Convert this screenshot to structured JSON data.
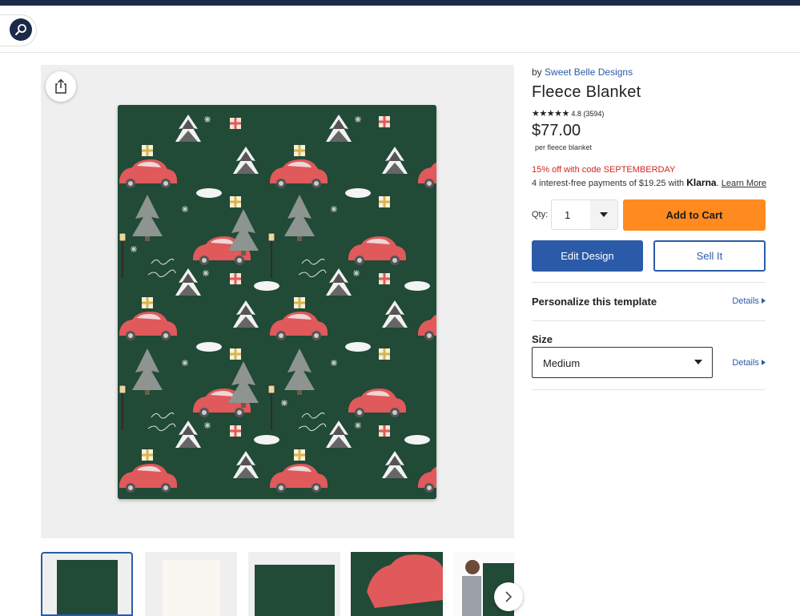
{
  "header": {
    "search_icon": "search-icon"
  },
  "product": {
    "byline_prefix": "by",
    "seller": "Sweet Belle Designs",
    "title": "Fleece Blanket",
    "stars": "★★★★★",
    "rating": "4.8",
    "review_count": "(3594)",
    "price": "$77.00",
    "per_unit": "per fleece blanket",
    "promo": "15% off with code SEPTEMBERDAY",
    "klarna_text": "4 interest-free payments of $19.25 with",
    "klarna_brand": "Klarna",
    "klarna_period": ".",
    "learn_more": "Learn More"
  },
  "purchase": {
    "qty_label": "Qty:",
    "qty_value": "1",
    "add_to_cart": "Add to Cart",
    "edit_design": "Edit Design",
    "sell_it": "Sell It"
  },
  "personalize": {
    "title": "Personalize this template",
    "details": "Details"
  },
  "size": {
    "label": "Size",
    "selected": "Medium",
    "details": "Details"
  },
  "colors": {
    "brand_navy": "#1c2a4a",
    "accent_blue": "#2b5ba8",
    "cart_orange": "#ff8a1f",
    "promo_red": "#d0281d",
    "blanket_green": "#214a37",
    "car_red": "#e0595b"
  }
}
